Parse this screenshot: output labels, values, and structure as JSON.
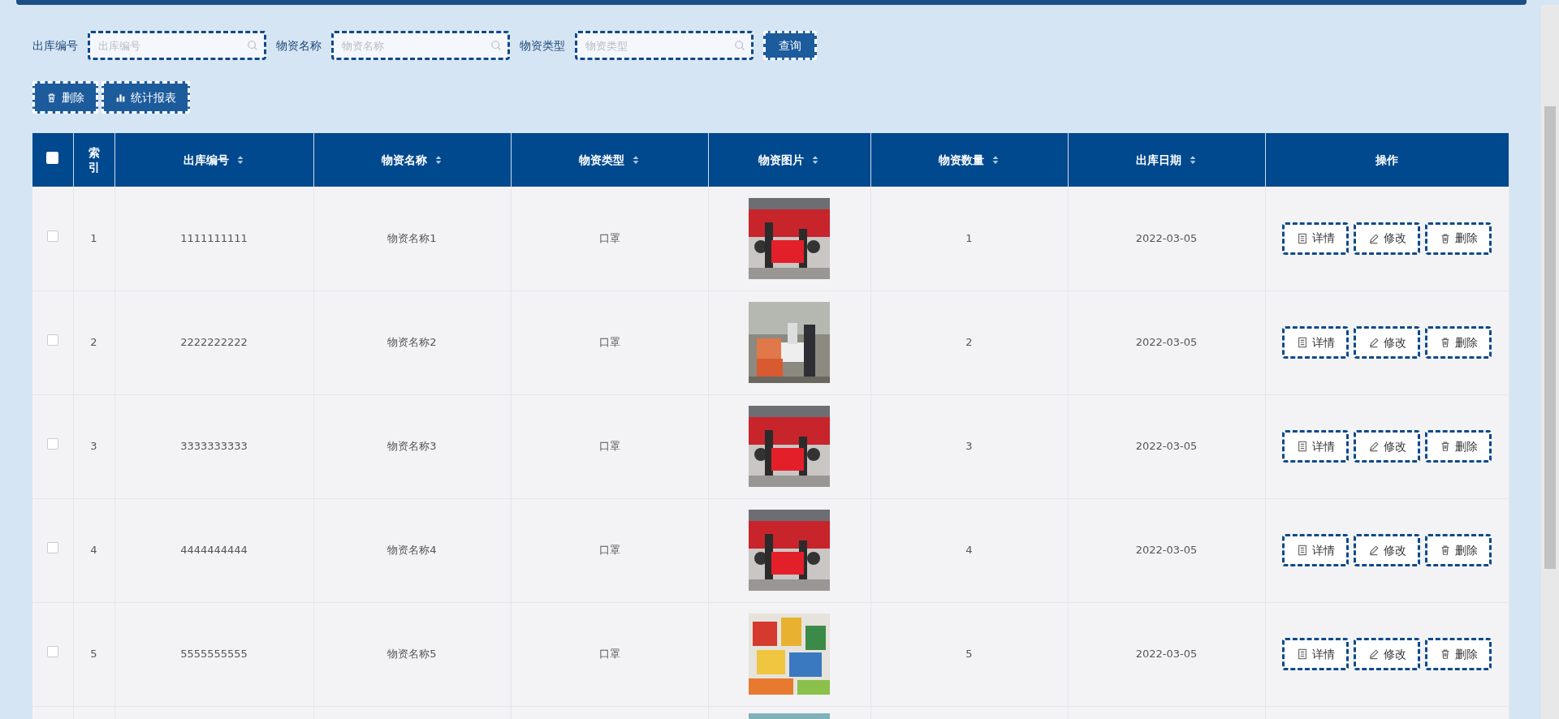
{
  "search": {
    "fields": [
      {
        "label": "出库编号",
        "placeholder": "出库编号"
      },
      {
        "label": "物资名称",
        "placeholder": "物资名称"
      },
      {
        "label": "物资类型",
        "placeholder": "物资类型"
      }
    ],
    "button": "查询"
  },
  "toolbar": [
    {
      "kind": "delete",
      "label": "删除"
    },
    {
      "kind": "report",
      "label": "统计报表"
    }
  ],
  "table": {
    "select_all": {
      "checked": false
    },
    "columns": [
      {
        "label": "索引",
        "sortable": false
      },
      {
        "label": "出库编号",
        "sortable": true
      },
      {
        "label": "物资名称",
        "sortable": true
      },
      {
        "label": "物资类型",
        "sortable": true
      },
      {
        "label": "物资图片",
        "sortable": true
      },
      {
        "label": "物资数量",
        "sortable": true
      },
      {
        "label": "出库日期",
        "sortable": true
      },
      {
        "label": "操作",
        "sortable": false
      }
    ],
    "rows": [
      {
        "kind": "full",
        "checked": false,
        "index": "1",
        "code": "1111111111",
        "name": "物资名称1",
        "type": "口罩",
        "quantity": "1",
        "date": "2022-03-05",
        "actions": [
          {
            "kind": "detail",
            "label": "详情"
          },
          {
            "kind": "edit",
            "label": "修改"
          },
          {
            "kind": "delete",
            "label": "删除"
          }
        ]
      },
      {
        "kind": "full",
        "checked": false,
        "index": "2",
        "code": "2222222222",
        "name": "物资名称2",
        "type": "口罩",
        "quantity": "2",
        "date": "2022-03-05",
        "actions": [
          {
            "kind": "detail",
            "label": "详情"
          },
          {
            "kind": "edit",
            "label": "修改"
          },
          {
            "kind": "delete",
            "label": "删除"
          }
        ]
      },
      {
        "kind": "full",
        "checked": false,
        "index": "3",
        "code": "3333333333",
        "name": "物资名称3",
        "type": "口罩",
        "quantity": "3",
        "date": "2022-03-05",
        "actions": [
          {
            "kind": "detail",
            "label": "详情"
          },
          {
            "kind": "edit",
            "label": "修改"
          },
          {
            "kind": "delete",
            "label": "删除"
          }
        ]
      },
      {
        "kind": "full",
        "checked": false,
        "index": "4",
        "code": "4444444444",
        "name": "物资名称4",
        "type": "口罩",
        "quantity": "4",
        "date": "2022-03-05",
        "actions": [
          {
            "kind": "detail",
            "label": "详情"
          },
          {
            "kind": "edit",
            "label": "修改"
          },
          {
            "kind": "delete",
            "label": "删除"
          }
        ]
      },
      {
        "kind": "full",
        "checked": false,
        "index": "5",
        "code": "5555555555",
        "name": "物资名称5",
        "type": "口罩",
        "quantity": "5",
        "date": "2022-03-05",
        "actions": [
          {
            "kind": "detail",
            "label": "详情"
          },
          {
            "kind": "edit",
            "label": "修改"
          },
          {
            "kind": "delete",
            "label": "删除"
          }
        ]
      },
      {
        "kind": "cut"
      }
    ]
  }
}
